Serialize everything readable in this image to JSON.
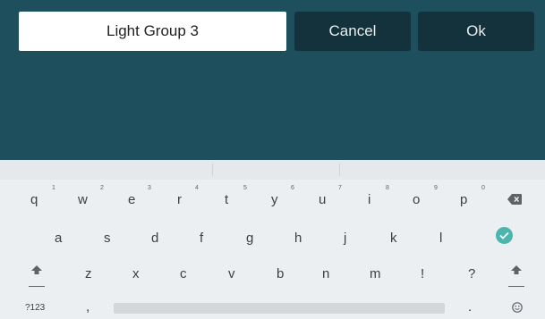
{
  "dialog": {
    "name_value": "Light Group 3",
    "cancel_label": "Cancel",
    "ok_label": "Ok"
  },
  "keyboard": {
    "row1": [
      {
        "key": "q",
        "hint": "1"
      },
      {
        "key": "w",
        "hint": "2"
      },
      {
        "key": "e",
        "hint": "3"
      },
      {
        "key": "r",
        "hint": "4"
      },
      {
        "key": "t",
        "hint": "5"
      },
      {
        "key": "y",
        "hint": "6"
      },
      {
        "key": "u",
        "hint": "7"
      },
      {
        "key": "i",
        "hint": "8"
      },
      {
        "key": "o",
        "hint": "9"
      },
      {
        "key": "p",
        "hint": "0"
      }
    ],
    "row2": [
      "a",
      "s",
      "d",
      "f",
      "g",
      "h",
      "j",
      "k",
      "l"
    ],
    "row3": [
      "z",
      "x",
      "c",
      "v",
      "b",
      "n",
      "m",
      "!",
      "?"
    ],
    "symbols_label": "?123",
    "comma": ",",
    "period": ".",
    "icons": {
      "backspace": "backspace-icon",
      "enter": "check-icon",
      "shift": "shift-icon",
      "emoji": "emoji-icon"
    },
    "accent_color": "#4db6ac"
  }
}
